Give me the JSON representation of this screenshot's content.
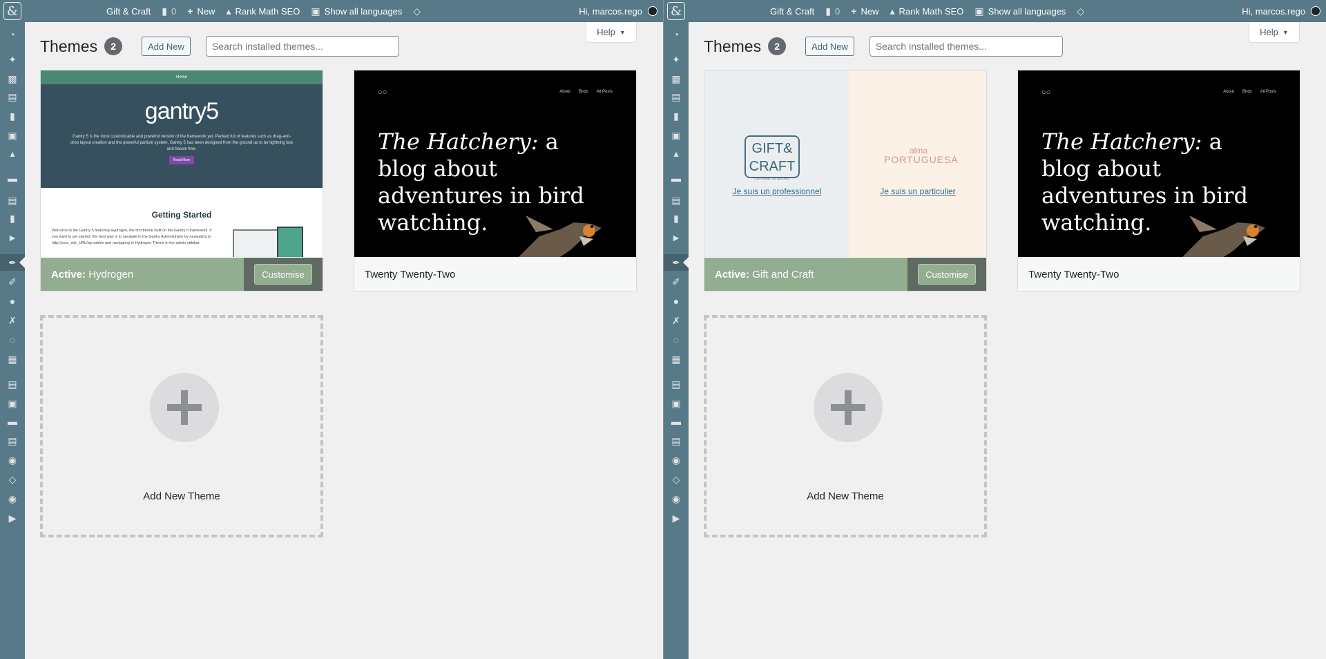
{
  "colors": {
    "admin_bar": "#587987",
    "active_bar": "#93ad90",
    "background": "#f0f0f1"
  },
  "panes": [
    {
      "adminbar": {
        "site_name": "Gift & Craft",
        "comments_count": "0",
        "new_label": "New",
        "seo_label": "Rank Math SEO",
        "languages_label": "Show all languages",
        "greeting": "Hi, marcos.rego"
      },
      "help_label": "Help",
      "page_title": "Themes",
      "theme_count": "2",
      "add_new_label": "Add New",
      "search_placeholder": "Search installed themes...",
      "active_theme": {
        "prefix": "Active:",
        "name": "Hydrogen",
        "customise_label": "Customise",
        "screenshot": {
          "nav": "Home",
          "logo": "gantry5",
          "tagline": "Gantry 5 is the most customizable and powerful version of the framework yet. Packed full of features such as drag-and-drop layout creation and the powerful particle system, Gantry 5 has been designed from the ground up to be lightning fast and hassle free.",
          "button": "Read More",
          "section_title": "Getting Started",
          "body": "Welcome to the Gantry 5 featuring Hydrogen, the first theme built on the Gantry 5 framework. If you want to get started, the best way is to navigate to the Gantry Administrator by navigating to http://your_site_URL/wp-admin and navigating to Hydrogen Theme in the admin sidebar."
        }
      },
      "other_theme": {
        "name": "Twenty Twenty-Two",
        "screenshot": {
          "nav": [
            "About",
            "Birds",
            "All Posts"
          ],
          "headline_italic": "The Hatchery:",
          "headline_rest": " a blog about adventures in bird watching."
        }
      },
      "add_theme_label": "Add New Theme"
    },
    {
      "adminbar": {
        "site_name": "Gift & Craft",
        "comments_count": "0",
        "new_label": "New",
        "seo_label": "Rank Math SEO",
        "languages_label": "Show all languages",
        "greeting": "Hi, marcos.rego"
      },
      "help_label": "Help",
      "page_title": "Themes",
      "theme_count": "2",
      "add_new_label": "Add New",
      "search_placeholder": "Search installed themes...",
      "active_theme": {
        "prefix": "Active:",
        "name": "Gift and Craft",
        "customise_label": "Customise",
        "screenshot": {
          "logo_line1": "GIFT&",
          "logo_line2": "CRAFT",
          "logo_sub": "L'ARTISANAT AU NATUREL",
          "link_left": "Je suis un professionnel",
          "brand_top": "alma",
          "brand_main": "PORTUGUESA",
          "link_right": "Je suis un particulier"
        }
      },
      "other_theme": {
        "name": "Twenty Twenty-Two",
        "screenshot": {
          "nav": [
            "About",
            "Birds",
            "All Posts"
          ],
          "headline_italic": "The Hatchery:",
          "headline_rest": " a blog about adventures in bird watching."
        }
      },
      "add_theme_label": "Add New Theme"
    }
  ]
}
